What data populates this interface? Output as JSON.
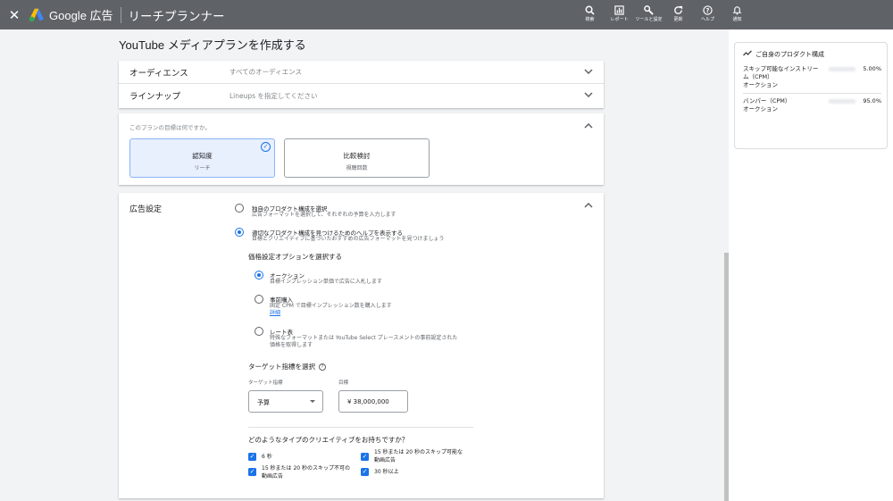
{
  "header": {
    "close": "✕",
    "brand": "Google 広告",
    "title": "リーチプランナー",
    "tools": [
      {
        "icon": "search-icon",
        "label": "検索"
      },
      {
        "icon": "report-icon",
        "label": "レポート"
      },
      {
        "icon": "wrench-icon",
        "label": "ツールと設定"
      },
      {
        "icon": "refresh-icon",
        "label": "更新"
      },
      {
        "icon": "help-icon",
        "label": "ヘルプ"
      },
      {
        "icon": "bell-icon",
        "label": "通知"
      }
    ]
  },
  "page_title": "YouTube メディアプランを作成する",
  "audience": {
    "label": "オーディエンス",
    "value": "すべてのオーディエンス"
  },
  "lineup": {
    "label": "ラインナップ",
    "value": "Lineups を指定してください"
  },
  "goal": {
    "question": "このプランの目標は何ですか。",
    "options": [
      {
        "title": "認知度",
        "sub": "リーチ",
        "selected": true
      },
      {
        "title": "比較検討",
        "sub": "視聴回数",
        "selected": false
      }
    ]
  },
  "ad_settings": {
    "label": "広告設定",
    "mode_options": [
      {
        "title": "独自のプロダクト構成を選択",
        "desc": "広告フォーマットを選択して、それぞれの予算を入力します",
        "selected": false
      },
      {
        "title": "適切なプロダクト構成を見つけるためのヘルプを表示する",
        "desc": "目標とクリエイティブに基づいたおすすめの広告フォーマットを見つけましょう",
        "selected": true
      }
    ],
    "pricing_heading": "価格設定オプションを選択する",
    "pricing_options": [
      {
        "title": "オークション",
        "desc": "目標インプレッション単価で広告に入札します",
        "selected": true
      },
      {
        "title": "事前購入",
        "desc": "固定 CPM で目標インプレッション数を購入します",
        "link": "詳細",
        "selected": false
      },
      {
        "title": "レート表",
        "desc1": "特殊なフォーマットまたは YouTube Select プレースメントの事前設定された",
        "desc2": "価格を取得します",
        "selected": false
      }
    ],
    "target_heading": "ターゲット指標を選択",
    "metric_label": "ターゲット指標",
    "metric_value": "予算",
    "goal_label": "目標",
    "goal_value": "¥ 38,000,000",
    "creative_heading": "どのようなタイプのクリエイティブをお持ちですか？",
    "creatives": [
      {
        "label": "6 秒",
        "checked": true
      },
      {
        "label1": "15 秒または 20 秒のスキップ可能な",
        "label2": "動画広告",
        "checked": true
      },
      {
        "label1": "15 秒または 20 秒のスキップ不可の",
        "label2": "動画広告",
        "checked": true
      },
      {
        "label": "30 秒以上",
        "checked": true
      }
    ]
  },
  "side_panel": {
    "title": "ご自身のプロダクト構成",
    "items": [
      {
        "name1": "スキップ可能なインストリー",
        "name2": "ム（CPM）",
        "sub": "オークション",
        "pct": "5.00%"
      },
      {
        "name1": "バンパー（CPM）",
        "sub": "オークション",
        "pct": "95.0%"
      }
    ]
  }
}
